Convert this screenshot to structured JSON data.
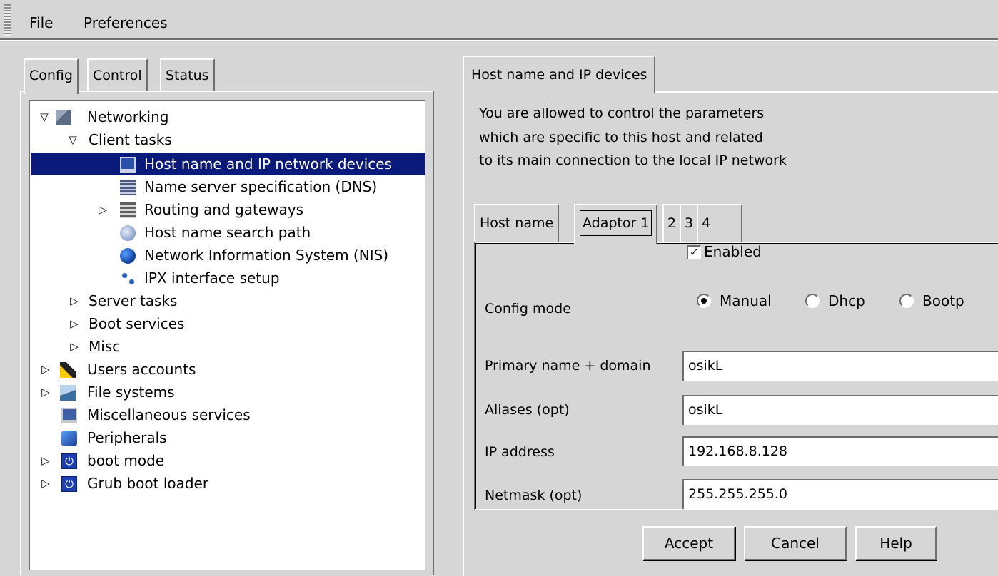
{
  "menubar": {
    "file": "File",
    "preferences": "Preferences"
  },
  "left_tabs": {
    "config": "Config",
    "control": "Control",
    "status": "Status"
  },
  "tree": {
    "networking": "Networking",
    "client_tasks": "Client tasks",
    "host_name_ip": "Host name and IP network devices",
    "dns": "Name server specification (DNS)",
    "routing": "Routing and gateways",
    "search_path": "Host name search path",
    "nis": "Network Information System (NIS)",
    "ipx": "IPX interface setup",
    "server_tasks": "Server tasks",
    "boot_services": "Boot services",
    "misc": "Misc",
    "users_accounts": "Users accounts",
    "file_systems": "File systems",
    "misc_services": "Miscellaneous services",
    "peripherals": "Peripherals",
    "boot_mode": "boot mode",
    "grub": "Grub boot loader"
  },
  "right": {
    "tab": "Host name and IP devices",
    "intro": [
      "You are allowed to control the parameters",
      "which are specific to this host and related",
      "to its main connection to the local IP network"
    ],
    "inner_tabs": {
      "host_name": "Host name",
      "adaptor1": "Adaptor 1",
      "t2": "2",
      "t3": "3",
      "t4": "4"
    },
    "enabled_label": "Enabled",
    "config_mode_label": "Config mode",
    "modes": {
      "manual": "Manual",
      "dhcp": "Dhcp",
      "bootp": "Bootp"
    },
    "selected_mode": "Manual",
    "fields": {
      "primary_label": "Primary name + domain",
      "primary_value": "osikL",
      "aliases_label": "Aliases (opt)",
      "aliases_value": "osikL",
      "ip_label": "IP address",
      "ip_value": "192.168.8.128",
      "netmask_label": "Netmask (opt)",
      "netmask_value": "255.255.255.0"
    },
    "buttons": {
      "accept": "Accept",
      "cancel": "Cancel",
      "help": "Help"
    }
  }
}
